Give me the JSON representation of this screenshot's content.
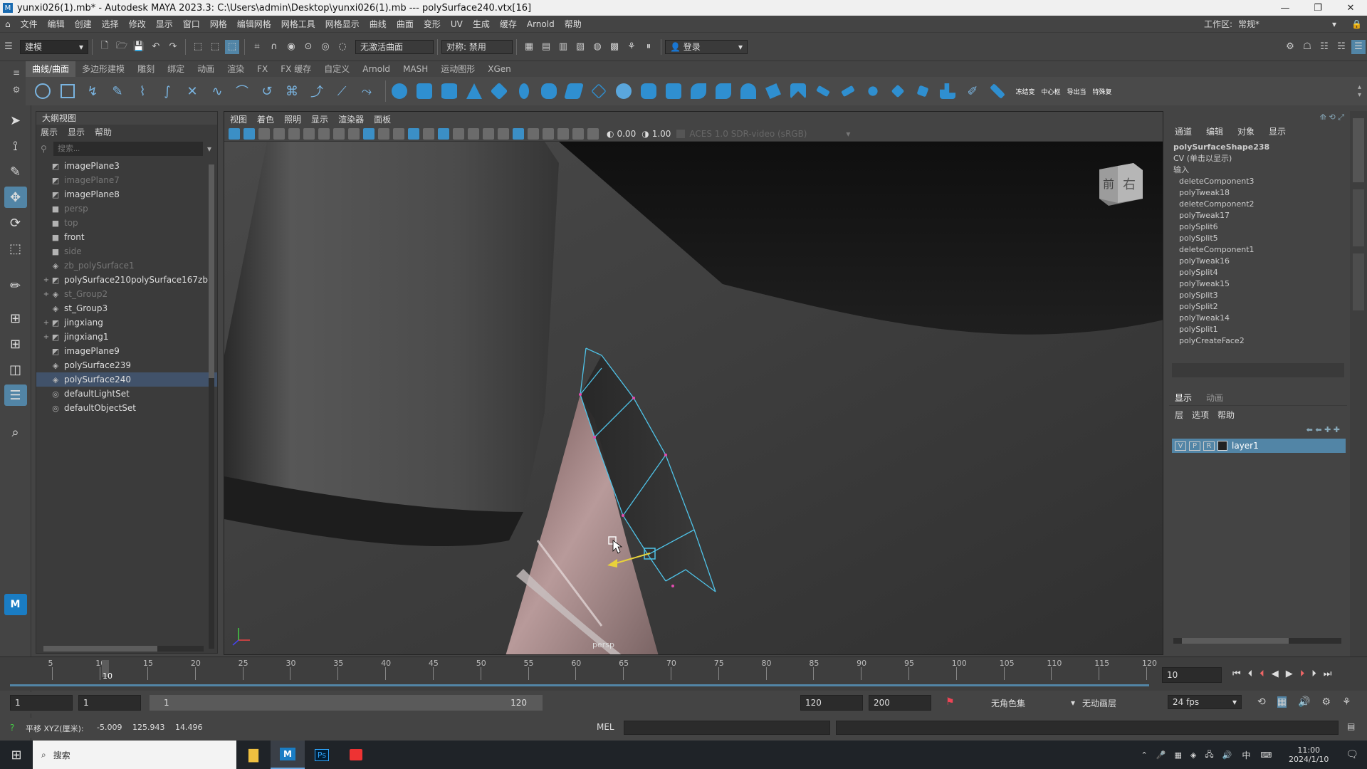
{
  "window": {
    "title": "yunxi026(1).mb* - Autodesk MAYA 2023.3: C:\\Users\\admin\\Desktop\\yunxi026(1).mb  ---  polySurface240.vtx[16]"
  },
  "menubar": {
    "items": [
      "文件",
      "编辑",
      "创建",
      "选择",
      "修改",
      "显示",
      "窗口",
      "网格",
      "编辑网格",
      "网格工具",
      "网格显示",
      "曲线",
      "曲面",
      "变形",
      "UV",
      "生成",
      "缓存",
      "Arnold",
      "帮助"
    ],
    "workspace_label": "工作区:",
    "workspace_value": "常规*"
  },
  "statusline": {
    "mode": "建模",
    "live_surface": "无激活曲面",
    "symmetry": "对称: 禁用",
    "login": "登录"
  },
  "shelf": {
    "tabs": [
      "曲线/曲面",
      "多边形建模",
      "雕刻",
      "绑定",
      "动画",
      "渲染",
      "FX",
      "FX 缓存",
      "自定义",
      "Arnold",
      "MASH",
      "运动图形",
      "XGen"
    ],
    "active_tab": "曲线/曲面",
    "label_buttons": [
      "冻结变",
      "中心枢",
      "导出当",
      "特殊复"
    ]
  },
  "outliner": {
    "title": "大纲视图",
    "menu": [
      "展示",
      "显示",
      "帮助"
    ],
    "search_placeholder": "搜索...",
    "items": [
      {
        "label": "imagePlane3",
        "icon": "image-plane-icon",
        "dim": false,
        "expand": ""
      },
      {
        "label": "imagePlane7",
        "icon": "image-plane-icon",
        "dim": true,
        "expand": ""
      },
      {
        "label": "imagePlane8",
        "icon": "image-plane-icon",
        "dim": false,
        "expand": ""
      },
      {
        "label": "persp",
        "icon": "camera-icon",
        "dim": true,
        "expand": ""
      },
      {
        "label": "top",
        "icon": "camera-icon",
        "dim": true,
        "expand": ""
      },
      {
        "label": "front",
        "icon": "camera-icon",
        "dim": false,
        "expand": ""
      },
      {
        "label": "side",
        "icon": "camera-icon",
        "dim": true,
        "expand": ""
      },
      {
        "label": "zb_polySurface1",
        "icon": "mesh-icon",
        "dim": true,
        "expand": ""
      },
      {
        "label": "polySurface210polySurface167zb",
        "icon": "group-icon",
        "dim": false,
        "expand": "+"
      },
      {
        "label": "st_Group2",
        "icon": "mesh-icon",
        "dim": true,
        "expand": "+"
      },
      {
        "label": "st_Group3",
        "icon": "mesh-icon",
        "dim": false,
        "expand": ""
      },
      {
        "label": "jingxiang",
        "icon": "group-icon",
        "dim": false,
        "expand": "+"
      },
      {
        "label": "jingxiang1",
        "icon": "group-icon",
        "dim": false,
        "expand": "+"
      },
      {
        "label": "imagePlane9",
        "icon": "image-plane-icon",
        "dim": false,
        "expand": ""
      },
      {
        "label": "polySurface239",
        "icon": "mesh-icon",
        "dim": false,
        "expand": ""
      },
      {
        "label": "polySurface240",
        "icon": "mesh-icon",
        "dim": false,
        "expand": "",
        "selected": true
      },
      {
        "label": "defaultLightSet",
        "icon": "set-icon",
        "dim": false,
        "expand": ""
      },
      {
        "label": "defaultObjectSet",
        "icon": "set-icon",
        "dim": false,
        "expand": ""
      }
    ]
  },
  "viewport": {
    "menu": [
      "视图",
      "着色",
      "照明",
      "显示",
      "渲染器",
      "面板"
    ],
    "exposure": "0.00",
    "gamma": "1.00",
    "colorspace": "ACES 1.0 SDR-video (sRGB)",
    "camera_label": "persp",
    "viewcube_front": "前",
    "viewcube_right": "右"
  },
  "channelbox": {
    "menu": [
      "通道",
      "编辑",
      "对象",
      "显示"
    ],
    "shape": "polySurfaceShape238",
    "cv_line": "CV (单击以显示)",
    "inputs_label": "输入",
    "inputs": [
      "deleteComponent3",
      "polyTweak18",
      "deleteComponent2",
      "polyTweak17",
      "polySplit6",
      "polySplit5",
      "deleteComponent1",
      "polyTweak16",
      "polySplit4",
      "polyTweak15",
      "polySplit3",
      "polySplit2",
      "polyTweak14",
      "polySplit1",
      "polyCreateFace2"
    ]
  },
  "layers": {
    "tabs": [
      "显示",
      "动画"
    ],
    "menu": [
      "层",
      "选项",
      "帮助"
    ],
    "row": {
      "v": "V",
      "p": "P",
      "r": "R",
      "name": "layer1"
    }
  },
  "timeline": {
    "ticks": [
      "5",
      "10",
      "15",
      "20",
      "25",
      "30",
      "35",
      "40",
      "45",
      "50",
      "55",
      "60",
      "65",
      "70",
      "75",
      "80",
      "85",
      "90",
      "95",
      "100",
      "105",
      "110",
      "115",
      "120"
    ],
    "current_frame": "10",
    "current_frame_field": "10"
  },
  "range": {
    "start": "1",
    "start2": "1",
    "slider_start": "1",
    "slider_end": "120",
    "end": "120",
    "end2": "200",
    "character_set": "无角色集",
    "anim_layer": "无动画层",
    "fps": "24 fps"
  },
  "cmdline": {
    "readout_label": "平移 XYZ(厘米):",
    "x": "-5.009",
    "y": "125.943",
    "z": "14.496",
    "lang": "MEL"
  },
  "taskbar": {
    "search": "搜索",
    "ime": "中",
    "time": "11:00",
    "date": "2024/1/10"
  },
  "colors": {
    "accent": "#5285a6",
    "selection": "#41526a",
    "wire": "#4fc3e8"
  }
}
